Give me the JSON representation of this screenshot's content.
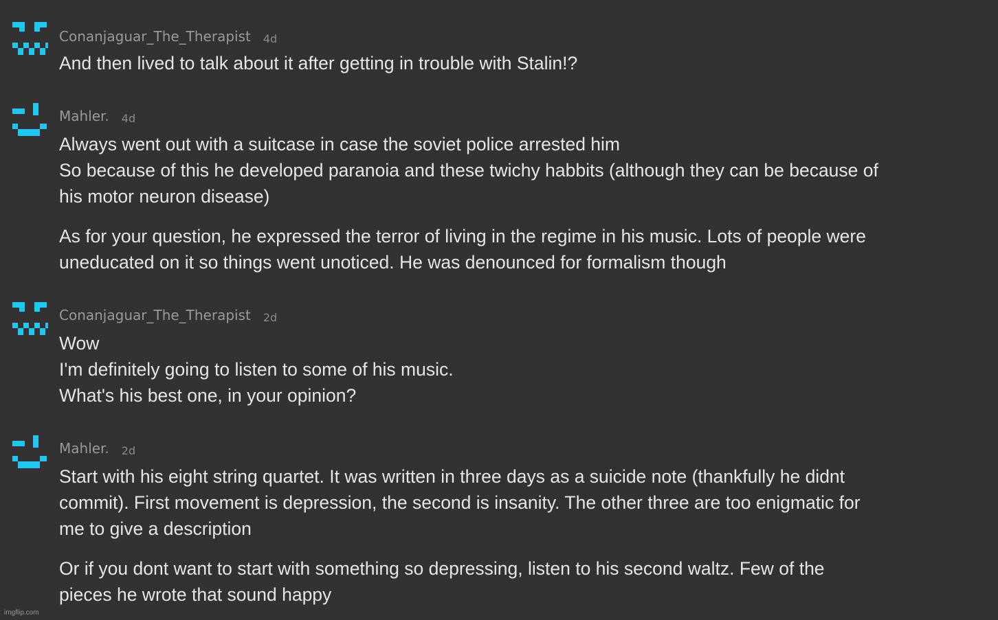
{
  "colors": {
    "background": "#323232",
    "avatar": "#1ec8f0",
    "text": "#e6e6e6",
    "username": "#9a9a9a"
  },
  "comments": [
    {
      "avatar": "pixel-face-frown-icon",
      "username": "Conanjaguar_The_Therapist",
      "time": "4d",
      "paragraphs": [
        [
          "And then lived to talk about it after getting in trouble with Stalin!?"
        ]
      ]
    },
    {
      "avatar": "pixel-face-smile-icon",
      "username": "Mahler.",
      "time": "4d",
      "paragraphs": [
        [
          "Always went out with a suitcase in case the soviet police arrested him",
          "So because of this he developed paranoia and these twichy habbits (although they can be because of",
          "his motor neuron disease)"
        ],
        [
          "As for your question, he expressed the terror of living in the regime in his music. Lots of people were",
          "uneducated on it so things went unoticed. He was denounced for formalism though"
        ]
      ]
    },
    {
      "avatar": "pixel-face-frown-icon",
      "username": "Conanjaguar_The_Therapist",
      "time": "2d",
      "paragraphs": [
        [
          "Wow",
          "I'm definitely going to listen to some of his music.",
          "What's his best one, in your opinion?"
        ]
      ]
    },
    {
      "avatar": "pixel-face-smile-icon",
      "username": "Mahler.",
      "time": "2d",
      "paragraphs": [
        [
          "Start with his eight string quartet. It was written in three days as a suicide note (thankfully he didnt",
          "commit). First movement is depression, the second is insanity. The other three are too enigmatic for",
          "me to give a description"
        ],
        [
          "Or if you dont want to start with something so depressing, listen to his second waltz. Few of the",
          "pieces he wrote that sound happy"
        ]
      ]
    }
  ],
  "watermark": "imgflip.com"
}
